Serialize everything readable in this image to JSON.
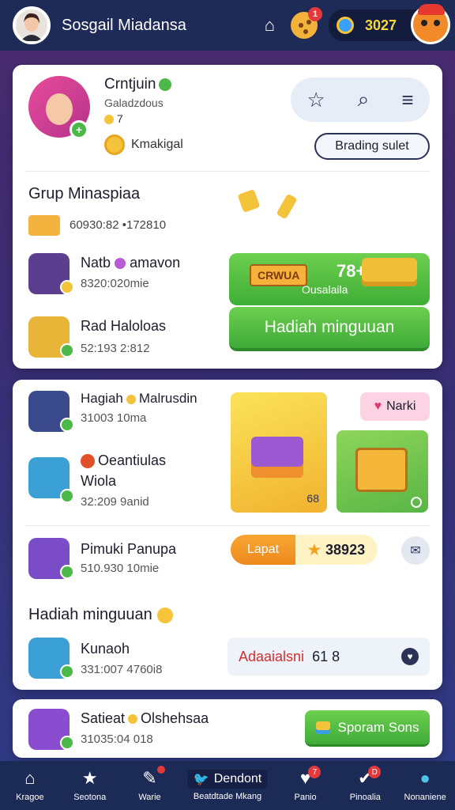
{
  "topbar": {
    "app_title": "Sosgail Miadansa",
    "home_glyph": "⌂",
    "cookie_badge": "1",
    "coins": "3027"
  },
  "profile": {
    "name": "Crntjuin",
    "subtitle": "Galadzdous",
    "level": "7",
    "coin_label": "Kmakigal",
    "plus": "+",
    "star_glyph": "☆",
    "search_glyph": "⌕",
    "menu_glyph": "≡",
    "branding_button": "Brading sulet"
  },
  "group": {
    "title": "Grup Minaspiaa",
    "code": "60930:82 •172810",
    "rows": [
      {
        "title": "Natb",
        "title2": "amavon",
        "sub": "8320:020mie"
      },
      {
        "title": "Rad Haloloas",
        "sub": "52:193 2:812"
      }
    ],
    "promo_tag": "CRWUA",
    "promo_value": "78+",
    "promo_sub": "Ousalaila",
    "hadiah_button": "Hadiah minguuan"
  },
  "card2": {
    "rows": [
      {
        "title": "Hagiah",
        "title2": "Malrusdin",
        "sub": "31003 10ma"
      },
      {
        "title": "Oeantiulas",
        "title2": "Wiola",
        "sub": "32:209 9anid"
      },
      {
        "title": "Pimuki Panupa",
        "sub": "510.930 10mie"
      }
    ],
    "pink_label": "Narki",
    "heart_glyph": "♥",
    "tile_num": "68",
    "lapat_label": "Lapat",
    "lapat_value": "38923",
    "star_glyph": "★",
    "chat_glyph": "✉",
    "hadiah_title": "Hadiah minguuan",
    "kunaoh_title": "Kunaoh",
    "kunaoh_sub": "331:007 4760i8",
    "addr_text": "Adaaialsni",
    "addr_num": "61 8",
    "addr_icon": "♥"
  },
  "card3": {
    "title": "Satieat",
    "title2": "Olshehsaa",
    "sub": "31035:04 018",
    "button": "Sporam Sons"
  },
  "bottomnav": [
    {
      "label": "Kragoe",
      "glyph": "⌂"
    },
    {
      "label": "Seotona",
      "glyph": "★"
    },
    {
      "label": "Warie",
      "glyph": "✎",
      "badge": ""
    },
    {
      "label": "Beatdtade Mkang",
      "glyph": "Dendont",
      "icon": "🐦"
    },
    {
      "label": "Panio",
      "glyph": "♥",
      "badge": "7"
    },
    {
      "label": "Pinoalia",
      "glyph": "✔",
      "badge": "D"
    },
    {
      "label": "Nonaniene",
      "glyph": "●"
    }
  ],
  "colors": {
    "accent_green": "#4bb847",
    "topbar": "#1f2b57",
    "coin_gold": "#f6d743"
  }
}
